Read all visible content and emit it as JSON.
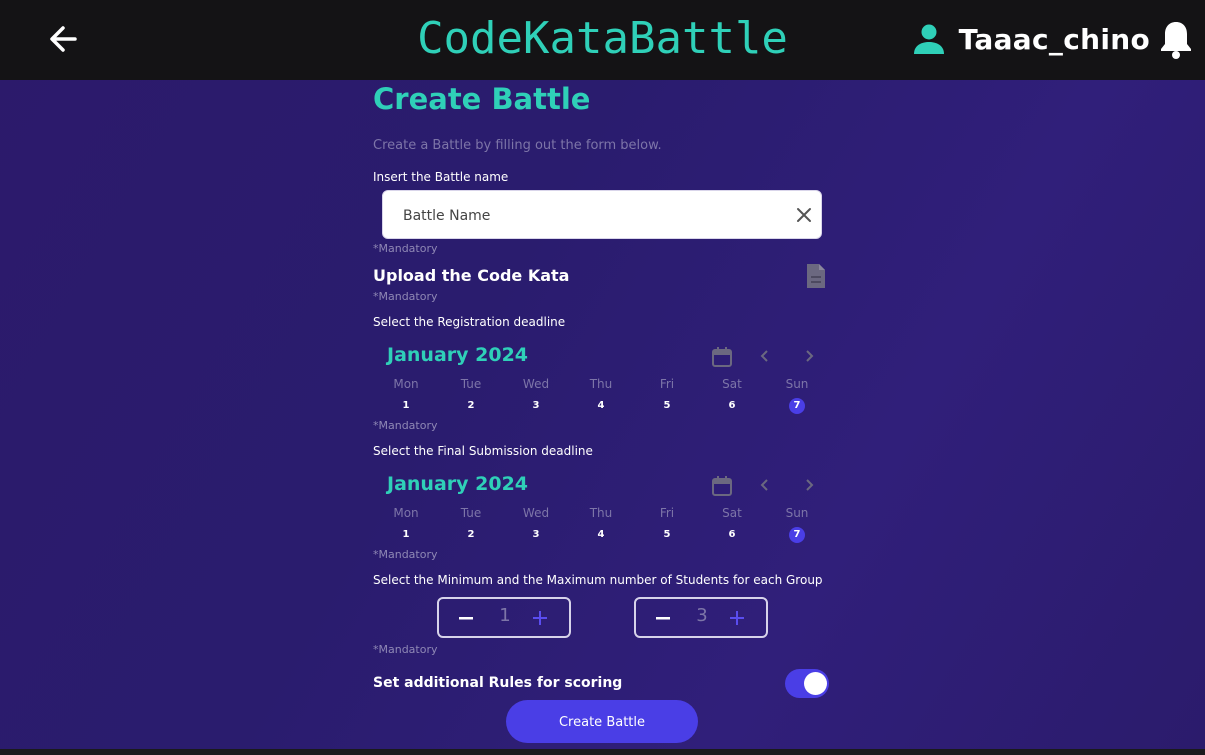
{
  "header": {
    "app_title": "CodeKataBattle",
    "username": "Taaac_chino"
  },
  "form": {
    "title": "Create Battle",
    "subtitle": "Create a Battle by filling out the form below.",
    "name_label": "Insert the Battle name",
    "name_placeholder": "Battle Name",
    "name_value": "",
    "mandatory_text": "*Mandatory",
    "upload_label": "Upload the Code Kata",
    "registration_label": "Select the Registration deadline",
    "submission_label": "Select the Final Submission deadline",
    "group_size_label": "Select the Minimum and the Maximum number of Students for each Group",
    "min_students": "1",
    "max_students": "3",
    "rules_label": "Set additional Rules for scoring",
    "rules_enabled": true,
    "create_button": "Create Battle"
  },
  "registration_calendar": {
    "month": "January 2024",
    "days": [
      {
        "name": "Mon",
        "date": "1"
      },
      {
        "name": "Tue",
        "date": "2"
      },
      {
        "name": "Wed",
        "date": "3"
      },
      {
        "name": "Thu",
        "date": "4"
      },
      {
        "name": "Fri",
        "date": "5"
      },
      {
        "name": "Sat",
        "date": "6"
      },
      {
        "name": "Sun",
        "date": "7"
      }
    ],
    "selected_date": "7"
  },
  "submission_calendar": {
    "month": "January 2024",
    "days": [
      {
        "name": "Mon",
        "date": "1"
      },
      {
        "name": "Tue",
        "date": "2"
      },
      {
        "name": "Wed",
        "date": "3"
      },
      {
        "name": "Thu",
        "date": "4"
      },
      {
        "name": "Fri",
        "date": "5"
      },
      {
        "name": "Sat",
        "date": "6"
      },
      {
        "name": "Sun",
        "date": "7"
      }
    ],
    "selected_date": "7"
  },
  "colors": {
    "accent": "#2fd0b8",
    "primary": "#4a3ee6",
    "topbar": "#141315",
    "background": "#2c1a6b"
  },
  "icons": [
    "back-arrow-icon",
    "user-icon",
    "bell-icon",
    "clear-icon",
    "file-icon",
    "calendar-icon",
    "chevron-left-icon",
    "chevron-right-icon",
    "minus-icon",
    "plus-icon"
  ]
}
